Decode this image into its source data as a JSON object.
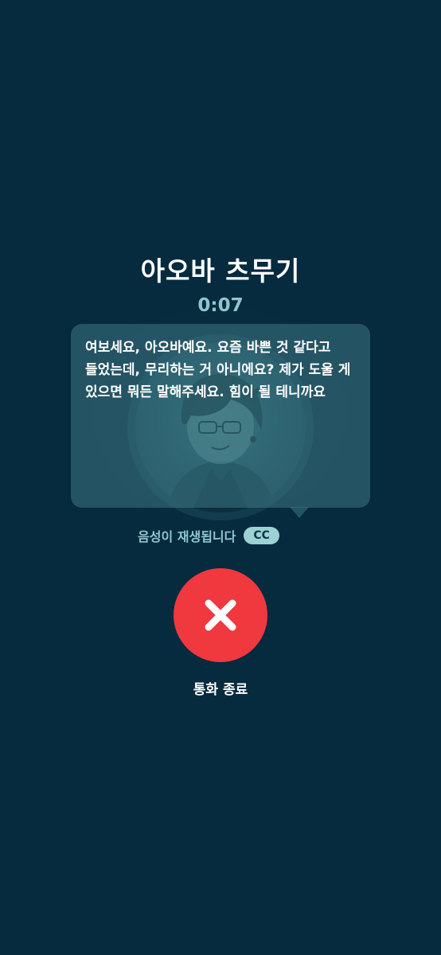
{
  "call": {
    "caller_name": "아오바 츠무기",
    "timer": "0:07",
    "caption": "여보세요, 아오바예요. 요즘 바쁜 것 같다고 들었는데, 무리하는 거 아니에요? 제가 도울 게 있으면 뭐든 말해주세요. 힘이 될 테니까요",
    "voice_status": "음성이 재생됩니다",
    "cc_label": "CC",
    "end_call_label": "통화 종료"
  },
  "icons": {
    "end_call": "close-x-icon"
  },
  "colors": {
    "background": "#062a3e",
    "timer": "#8fc6cc",
    "end_call": "#f0383f",
    "cc_badge": "#9cd2d3"
  }
}
